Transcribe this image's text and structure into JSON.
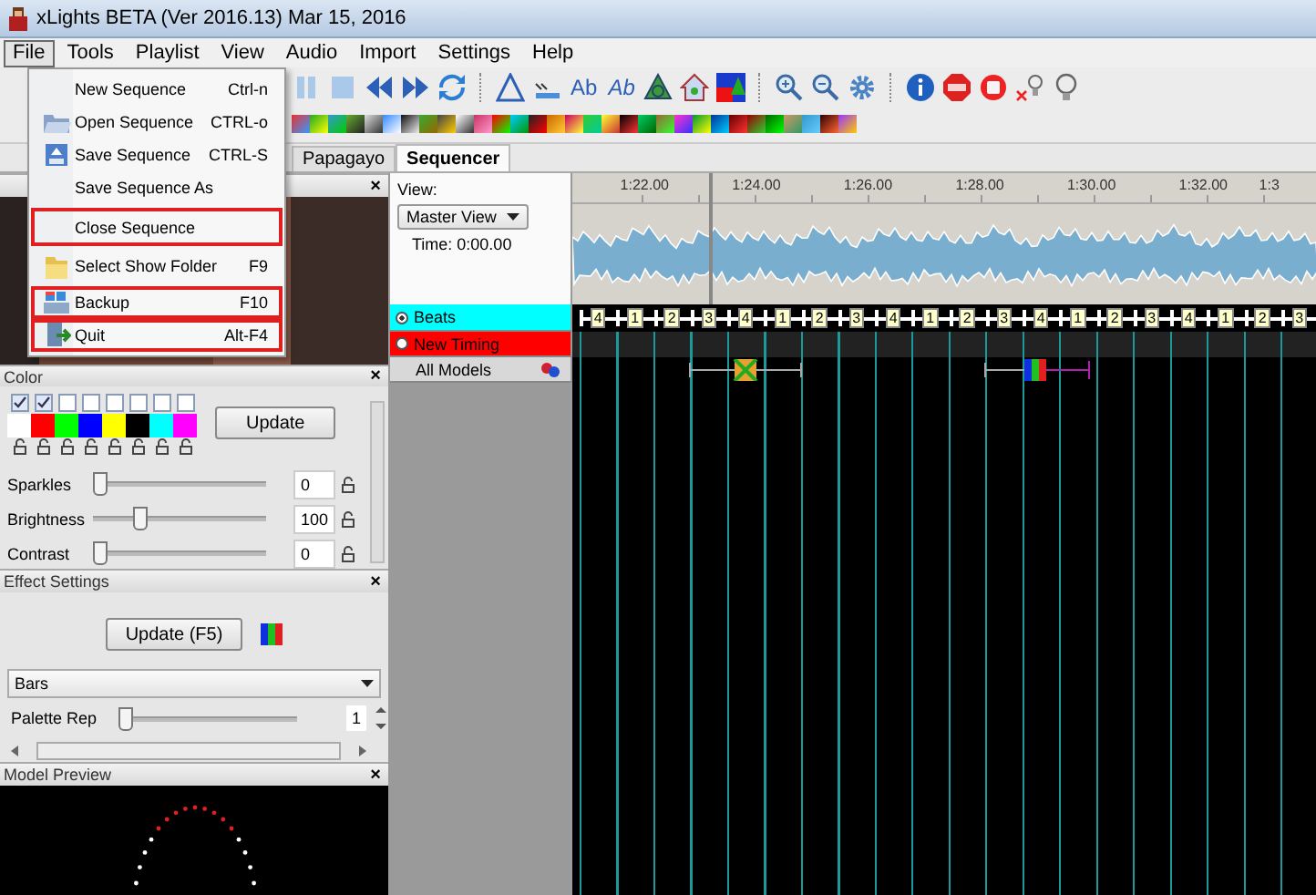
{
  "window": {
    "title": "xLights BETA (Ver 2016.13) Mar 15, 2016"
  },
  "menu_bar": [
    {
      "label": "File",
      "selected": true
    },
    {
      "label": "Tools",
      "selected": false
    },
    {
      "label": "Playlist",
      "selected": false
    },
    {
      "label": "View",
      "selected": false
    },
    {
      "label": "Audio",
      "selected": false
    },
    {
      "label": "Import",
      "selected": false
    },
    {
      "label": "Settings",
      "selected": false
    },
    {
      "label": "Help",
      "selected": false
    }
  ],
  "toolbar": {
    "text_buttons": [
      "Ab",
      "Ab"
    ]
  },
  "file_menu": [
    {
      "label": "New Sequence",
      "shortcut": "Ctrl-n",
      "kind": "plain",
      "marked": false
    },
    {
      "label": "Open Sequence",
      "shortcut": "CTRL-o",
      "kind": "open",
      "marked": false
    },
    {
      "label": "Save Sequence",
      "shortcut": "CTRL-S",
      "kind": "save",
      "marked": false
    },
    {
      "label": "Save Sequence As",
      "kind": "plain",
      "marked": false
    },
    {
      "label": "Close Sequence",
      "kind": "plain",
      "marked": true
    },
    {
      "label": "Select Show Folder",
      "shortcut": "F9",
      "kind": "folder",
      "marked": false
    },
    {
      "label": "Backup",
      "shortcut": "F10",
      "kind": "backup",
      "marked": true
    },
    {
      "label": "Quit",
      "shortcut": "Alt-F4",
      "kind": "quit",
      "marked": true
    }
  ],
  "tabs": [
    {
      "label": "Papagayo",
      "selected": false
    },
    {
      "label": "Sequencer",
      "selected": true
    }
  ],
  "house_panel": {
    "close": "×"
  },
  "color_panel": {
    "title": "Color",
    "close": "×",
    "update_button": "Update",
    "palette": [
      {
        "color": "#ffffff",
        "checked": true
      },
      {
        "color": "#ff0000",
        "checked": true
      },
      {
        "color": "#00ff00",
        "checked": false
      },
      {
        "color": "#0000ff",
        "checked": false
      },
      {
        "color": "#ffff00",
        "checked": false
      },
      {
        "color": "#000000",
        "checked": false
      },
      {
        "color": "#00ffff",
        "checked": false
      },
      {
        "color": "#ff00ff",
        "checked": false
      }
    ],
    "sliders": [
      {
        "label": "Sparkles",
        "level": 0,
        "value": "0"
      },
      {
        "label": "Brightness",
        "level": 0.25,
        "value": "100"
      },
      {
        "label": "Contrast",
        "level": 0,
        "value": "0"
      }
    ]
  },
  "effect_settings": {
    "title": "Effect Settings",
    "close": "×",
    "update_button": "Update (F5)",
    "effect": "Bars",
    "sliders": [
      {
        "label": "Palette Rep",
        "level": 0,
        "value": "1"
      }
    ]
  },
  "model_preview": {
    "title": "Model Preview",
    "close": "×"
  },
  "sequencer": {
    "view_label": "View:",
    "view": "Master View",
    "time": "Time: 0:00.00",
    "ruler": [
      "1:22.00",
      "1:24.00",
      "1:26.00",
      "1:28.00",
      "1:30.00",
      "1:32.00",
      "1:3"
    ],
    "rows": [
      {
        "label": "Beats",
        "kind": "timing",
        "color": "#00ffff",
        "selected": true
      },
      {
        "label": "New Timing",
        "kind": "timing",
        "color": "#ff0000",
        "selected": false
      },
      {
        "label": "All Models",
        "kind": "model"
      }
    ],
    "beats": [
      "4",
      "1",
      "2",
      "3",
      "4",
      "1",
      "2",
      "3",
      "4",
      "1",
      "2",
      "3",
      "4",
      "1",
      "2",
      "3",
      "4",
      "1",
      "2",
      "3"
    ]
  }
}
